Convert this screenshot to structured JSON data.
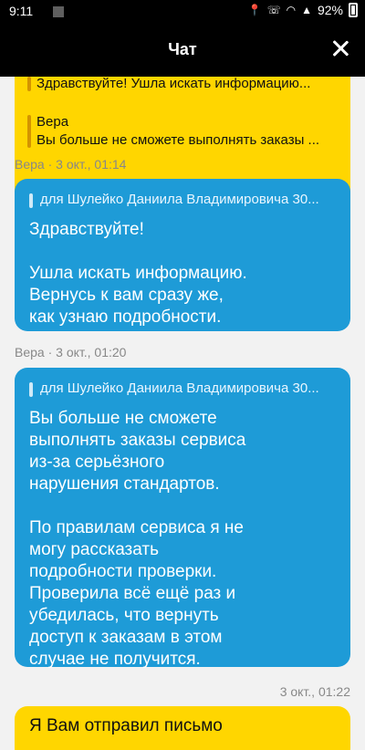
{
  "status": {
    "time": "9:11",
    "battery": "92%"
  },
  "header": {
    "title": "Чат"
  },
  "top_bubble": {
    "quote1": "Здравствуйте! Ушла искать информацию...",
    "quote2_author": "Вера",
    "quote2_text": "Вы больше не сможете выполнять заказы ..."
  },
  "messages": [
    {
      "meta": "Вера · 3 окт., 01:14",
      "quote": "для Шулейко Даниила Владимировича 30...",
      "text": "Здравствуйте!\n\nУшла искать информацию.\nВернусь к вам сразу же,\nкак узнаю подробности."
    },
    {
      "meta": "Вера · 3 окт., 01:20",
      "quote": "для Шулейко Даниила Владимировича 30...",
      "text": "Вы больше не сможете\nвыполнять заказы сервиса\nиз-за серьёзного\nнарушения стандартов.\n\nПо правилам сервиса я не\nмогу рассказать\nподробности проверки.\nПроверила всё ещё раз и\nубедилась, что вернуть\nдоступ к заказам в этом\nслучае не получится."
    }
  ],
  "outgoing": {
    "meta": "3 окт., 01:22",
    "text": "Я Вам отправил письмо"
  }
}
